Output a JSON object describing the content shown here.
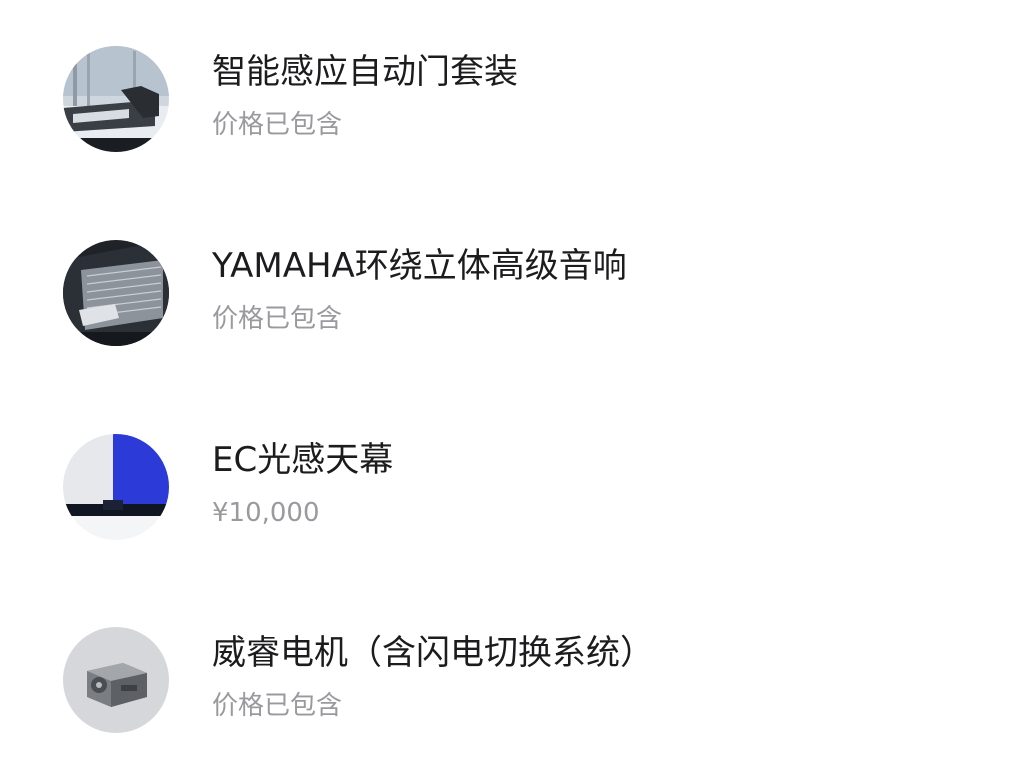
{
  "options": [
    {
      "title": "智能感应自动门套装",
      "subtitle": "价格已包含",
      "image": "automatic-door-photo"
    },
    {
      "title": "YAMAHA环绕立体高级音响",
      "subtitle": "价格已包含",
      "image": "speaker-grille-photo"
    },
    {
      "title": "EC光感天幕",
      "subtitle": "¥10,000",
      "image": "sunroof-photo"
    },
    {
      "title": "威睿电机（含闪电切换系统）",
      "subtitle": "价格已包含",
      "image": "electric-motor-photo"
    }
  ]
}
